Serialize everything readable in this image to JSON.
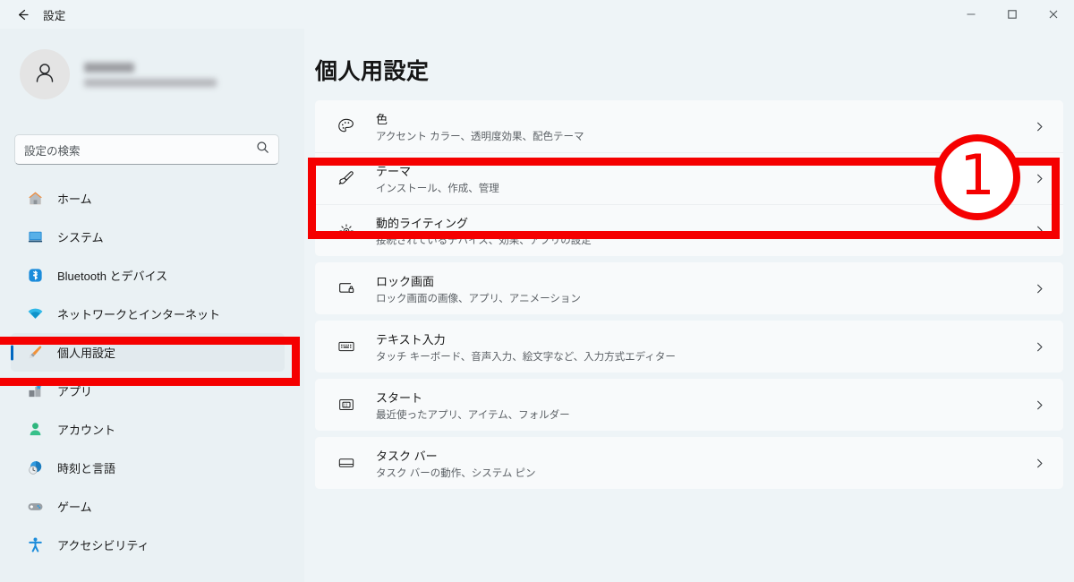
{
  "titlebar": {
    "back_icon": "back-arrow-icon",
    "title": "設定",
    "minimize_label": "minimize-icon",
    "maximize_label": "maximize-icon",
    "close_label": "close-icon"
  },
  "sidebar": {
    "profile": {
      "avatar_icon": "person-avatar-icon",
      "name_redacted": true,
      "email_redacted": true
    },
    "search": {
      "placeholder": "設定の検索",
      "icon": "search-icon"
    },
    "items": [
      {
        "label": "ホーム",
        "icon": "home-icon",
        "selected": false
      },
      {
        "label": "システム",
        "icon": "system-icon",
        "selected": false
      },
      {
        "label": "Bluetooth とデバイス",
        "icon": "bluetooth-icon",
        "selected": false
      },
      {
        "label": "ネットワークとインターネット",
        "icon": "network-icon",
        "selected": false
      },
      {
        "label": "個人用設定",
        "icon": "personalization-icon",
        "selected": true
      },
      {
        "label": "アプリ",
        "icon": "apps-icon",
        "selected": false
      },
      {
        "label": "アカウント",
        "icon": "accounts-icon",
        "selected": false
      },
      {
        "label": "時刻と言語",
        "icon": "time-language-icon",
        "selected": false
      },
      {
        "label": "ゲーム",
        "icon": "gaming-icon",
        "selected": false
      },
      {
        "label": "アクセシビリティ",
        "icon": "accessibility-icon",
        "selected": false
      }
    ]
  },
  "main": {
    "page_title": "個人用設定",
    "groups": [
      {
        "rows": [
          {
            "title": "色",
            "subtitle": "アクセント カラー、透明度効果、配色テーマ",
            "icon": "palette-icon",
            "chevron": "chevron-right-icon"
          },
          {
            "title": "テーマ",
            "subtitle": "インストール、作成、管理",
            "icon": "paintbrush-icon",
            "chevron": "chevron-right-icon"
          },
          {
            "title": "動的ライティング",
            "subtitle": "接続されているデバイス、効果、アプリの設定",
            "icon": "dynamic-lighting-icon",
            "chevron": "chevron-right-icon"
          }
        ]
      },
      {
        "rows": [
          {
            "title": "ロック画面",
            "subtitle": "ロック画面の画像、アプリ、アニメーション",
            "icon": "lock-screen-icon",
            "chevron": "chevron-right-icon"
          }
        ]
      },
      {
        "rows": [
          {
            "title": "テキスト入力",
            "subtitle": "タッチ キーボード、音声入力、絵文字など、入力方式エディター",
            "icon": "keyboard-icon",
            "chevron": "chevron-right-icon"
          }
        ]
      },
      {
        "rows": [
          {
            "title": "スタート",
            "subtitle": "最近使ったアプリ、アイテム、フォルダー",
            "icon": "start-menu-icon",
            "chevron": "chevron-right-icon"
          }
        ]
      },
      {
        "rows": [
          {
            "title": "タスク バー",
            "subtitle": "タスク バーの動作、システム ピン",
            "icon": "taskbar-icon",
            "chevron": "chevron-right-icon"
          }
        ]
      }
    ]
  },
  "annotations": {
    "color": "#f50000",
    "step_number": "1",
    "sidebar_box_target": "個人用設定",
    "theme_box_target": "テーマ"
  }
}
